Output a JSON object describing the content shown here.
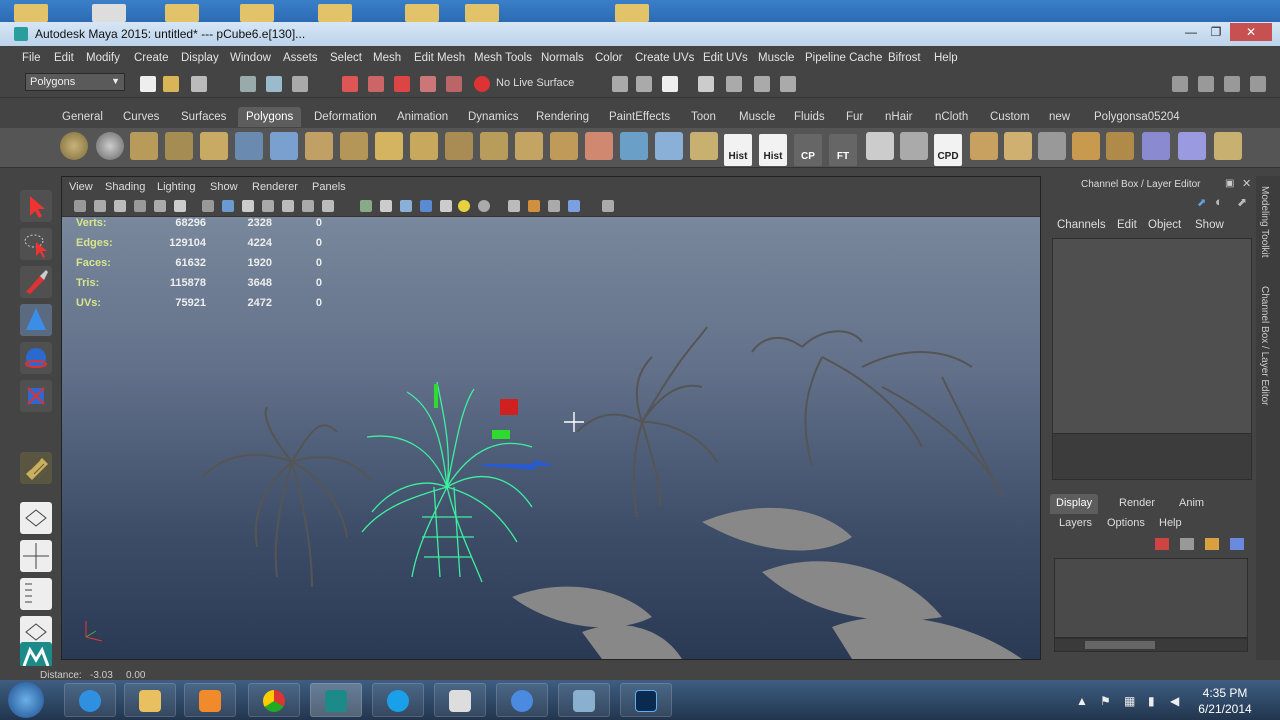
{
  "colors": {
    "viewport_top": "#7f8ea0",
    "viewport_bottom": "#2a3a54",
    "selection_wire": "#3cf0a0",
    "hud_label": "#d8e58c",
    "ui_bg": "#444444"
  },
  "window": {
    "title": "Autodesk Maya 2015: untitled*   ---   pCube6.e[130]...",
    "minimize": "—",
    "maximize": "❐",
    "close": "✕"
  },
  "menu": [
    "File",
    "Edit",
    "Modify",
    "Create",
    "Display",
    "Window",
    "Assets",
    "Select",
    "Mesh",
    "Edit Mesh",
    "Mesh Tools",
    "Normals",
    "Color",
    "Create UVs",
    "Edit UVs",
    "Muscle",
    "Pipeline Cache",
    "Bifrost",
    "Help"
  ],
  "status": {
    "menu_set": "Polygons",
    "live_surface": "No Live Surface"
  },
  "shelf_tabs": [
    "General",
    "Curves",
    "Surfaces",
    "Polygons",
    "Deformation",
    "Animation",
    "Dynamics",
    "Rendering",
    "PaintEffects",
    "Toon",
    "Muscle",
    "Fluids",
    "Fur",
    "nHair",
    "nCloth",
    "Custom",
    "new",
    "Polygonsa05204"
  ],
  "shelf_active": "Polygons",
  "shelf_labels": [
    "Hist",
    "Hist",
    "CP",
    "FT",
    "CPD"
  ],
  "viewport_menu": [
    "View",
    "Shading",
    "Lighting",
    "Show",
    "Renderer",
    "Panels"
  ],
  "hud": [
    {
      "label": "Verts:",
      "a": "68296",
      "b": "2328",
      "c": "0"
    },
    {
      "label": "Edges:",
      "a": "129104",
      "b": "4224",
      "c": "0"
    },
    {
      "label": "Faces:",
      "a": "61632",
      "b": "1920",
      "c": "0"
    },
    {
      "label": "Tris:",
      "a": "115878",
      "b": "3648",
      "c": "0"
    },
    {
      "label": "UVs:",
      "a": "75921",
      "b": "2472",
      "c": "0"
    }
  ],
  "channel_box": {
    "title": "Channel Box / Layer Editor",
    "menus": [
      "Channels",
      "Edit",
      "Object",
      "Show"
    ],
    "layer_tabs": [
      "Display",
      "Render",
      "Anim"
    ],
    "layer_menus": [
      "Layers",
      "Options",
      "Help"
    ]
  },
  "side_tabs": [
    "Modeling Toolkit",
    "Channel Box / Layer Editor"
  ],
  "help_line": {
    "label": "Distance:",
    "a": "-3.03",
    "b": "0.00"
  },
  "taskbar": {
    "time": "4:35 PM",
    "date": "6/21/2014"
  },
  "icons": [
    "start-orb-icon",
    "ie-icon",
    "explorer-folder-icon",
    "media-player-icon",
    "chrome-icon",
    "maya-icon",
    "skype-icon",
    "zbrush-icon",
    "flower-app-icon",
    "remote-desktop-icon",
    "photoshop-icon"
  ]
}
